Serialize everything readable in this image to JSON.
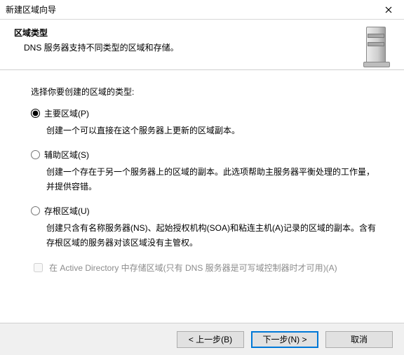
{
  "window": {
    "title": "新建区域向导"
  },
  "header": {
    "title": "区域类型",
    "description": "DNS 服务器支持不同类型的区域和存储。"
  },
  "prompt": "选择你要创建的区域的类型:",
  "options": {
    "primary": {
      "label": "主要区域(P)",
      "description": "创建一个可以直接在这个服务器上更新的区域副本。"
    },
    "secondary": {
      "label": "辅助区域(S)",
      "description": "创建一个存在于另一个服务器上的区域的副本。此选项帮助主服务器平衡处理的工作量，并提供容错。"
    },
    "stub": {
      "label": "存根区域(U)",
      "description": "创建只含有名称服务器(NS)、起始授权机构(SOA)和粘连主机(A)记录的区域的副本。含有存根区域的服务器对该区域没有主管权。"
    }
  },
  "adcheckbox": {
    "label": "在 Active Directory 中存储区域(只有 DNS 服务器是可写域控制器时才可用)(A)"
  },
  "buttons": {
    "back": "< 上一步(B)",
    "next": "下一步(N) >",
    "cancel": "取消"
  }
}
